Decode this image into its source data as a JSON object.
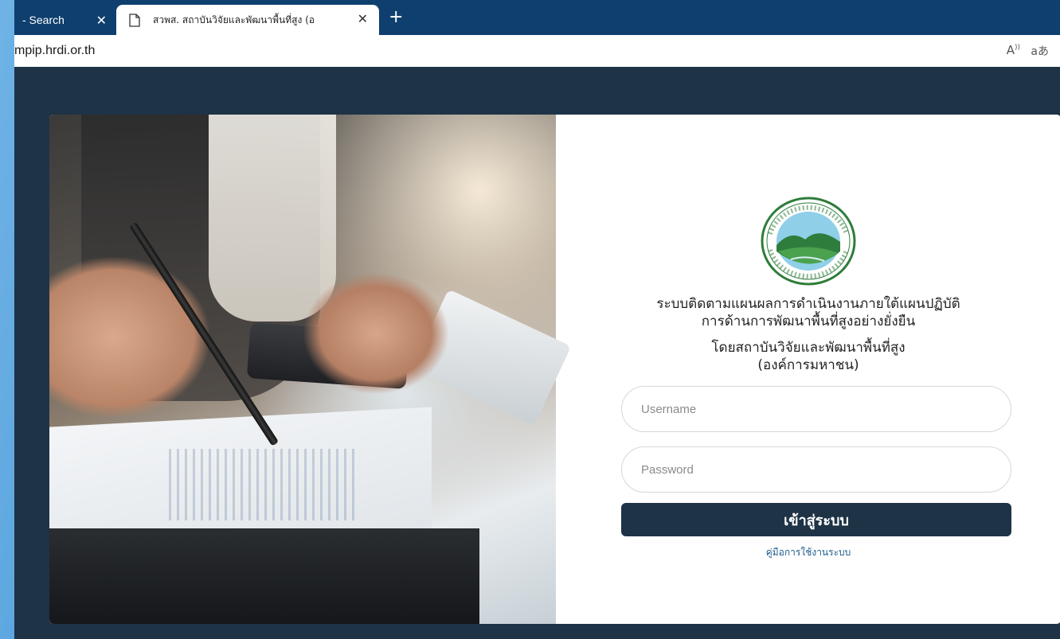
{
  "browser": {
    "tabs": [
      {
        "title": "- Search",
        "active": false
      },
      {
        "title": "สวพส. สถาบันวิจัยและพัฒนาพื้นที่สูง (อ",
        "active": true
      }
    ],
    "close_glyph": "✕",
    "new_tab_glyph": "+",
    "url": "mpip.hrdi.or.th",
    "read_aloud_label": "A",
    "translate_label": "aあ"
  },
  "login": {
    "title_line1": "ระบบติดตามแผนผลการดำเนินงานภายใต้แผนปฏิบัติ",
    "title_line2": "การด้านการพัฒนาพื้นที่สูงอย่างยั่งยืน",
    "org_line1": "โดยสถาบันวิจัยและพัฒนาพื้นที่สูง",
    "org_line2": "(องค์การมหาชน)",
    "username_placeholder": "Username",
    "password_placeholder": "Password",
    "submit_label": "เข้าสู่ระบบ",
    "manual_link": "คู่มือการใช้งานระบบ"
  },
  "colors": {
    "page_background": "#1e3346",
    "button": "#1e3346",
    "tabbar": "#0e3f6e",
    "link": "#1e5f8a"
  }
}
